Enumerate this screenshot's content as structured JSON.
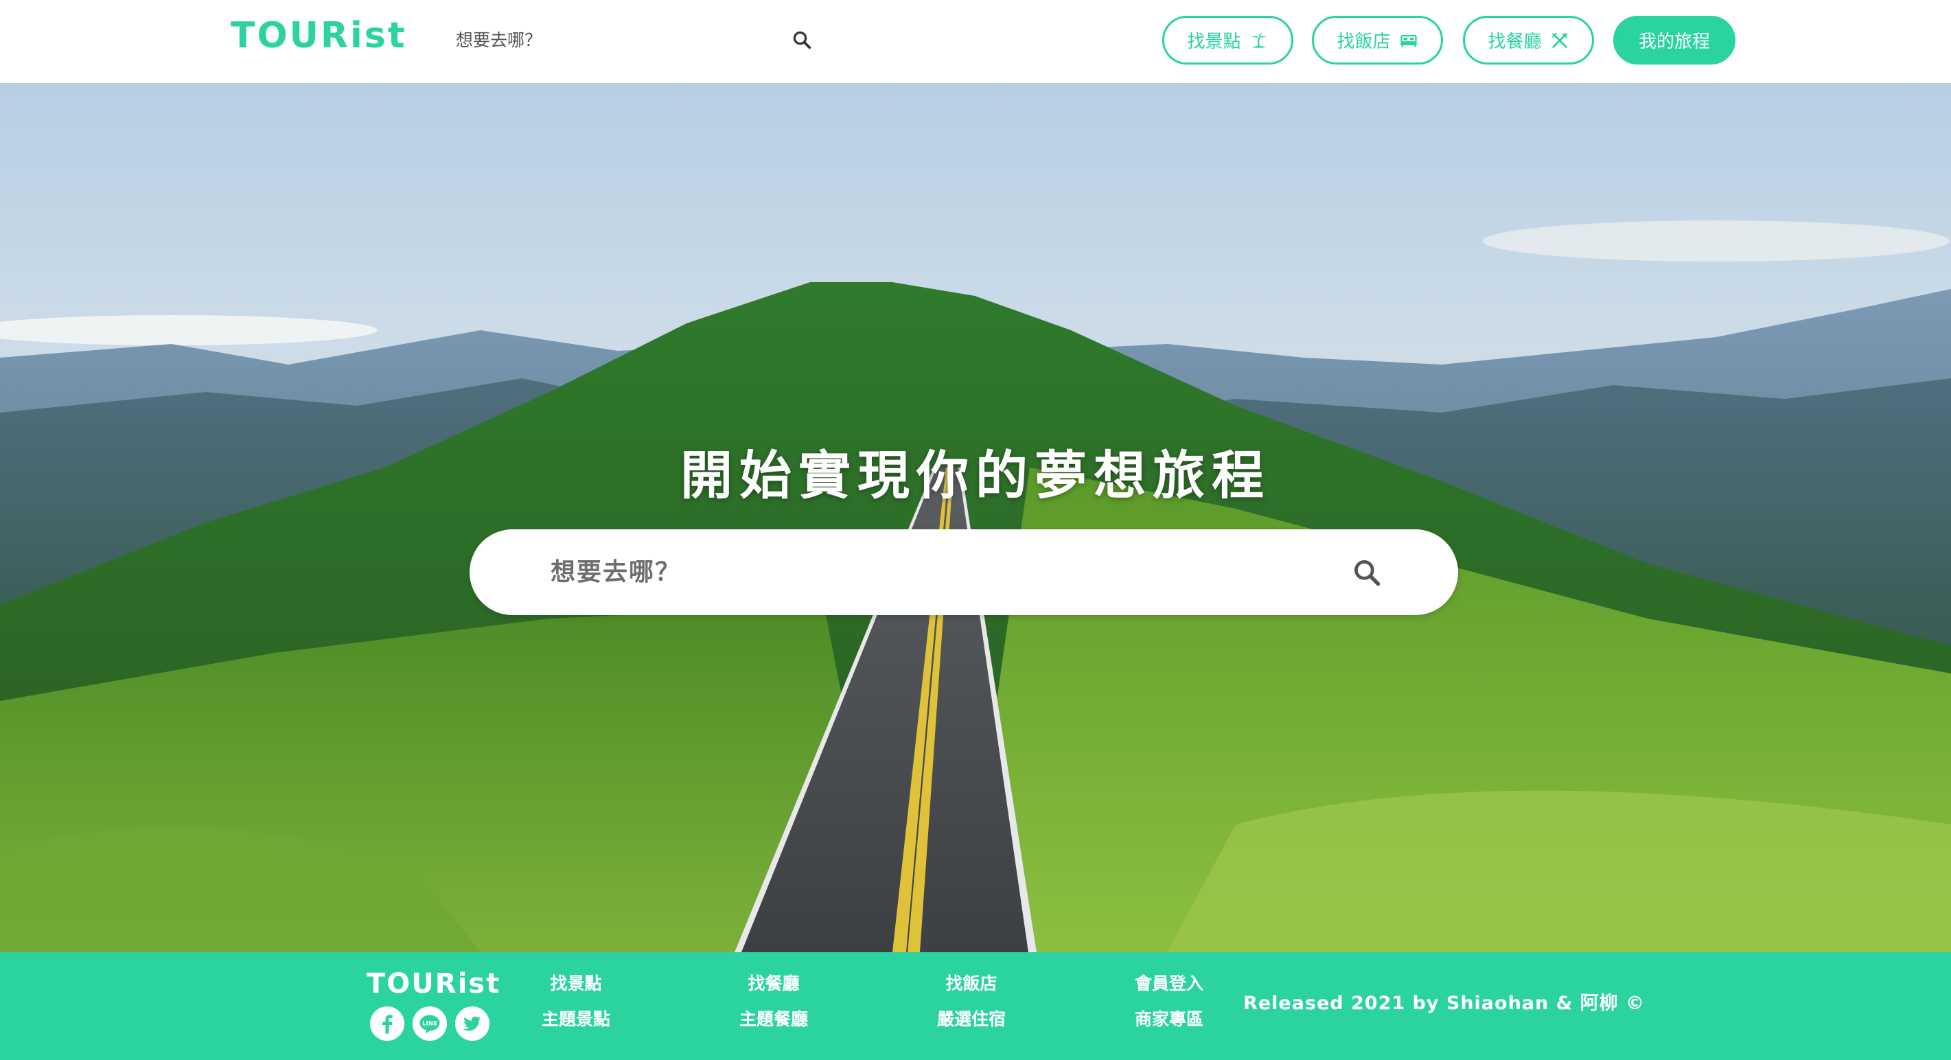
{
  "brand": {
    "logo_text": "TOURist",
    "color_primary": "#2ad3a0"
  },
  "header": {
    "search": {
      "placeholder": "想要去哪？",
      "icon": "search-icon"
    },
    "nav": {
      "spots": {
        "label": "找景點",
        "icon": "palm-tree-icon"
      },
      "hotels": {
        "label": "找飯店",
        "icon": "bed-icon"
      },
      "restaurants": {
        "label": "找餐廳",
        "icon": "utensils-icon"
      },
      "my_trip": {
        "label": "我的旅程"
      }
    }
  },
  "hero": {
    "title": "開始實現你的夢想旅程",
    "search": {
      "placeholder": "想要去哪？",
      "icon": "search-icon"
    }
  },
  "footer": {
    "logo_text": "TOURist",
    "social": [
      "facebook-icon",
      "line-icon",
      "twitter-icon"
    ],
    "links": {
      "spots": "找景點",
      "theme_spots": "主題景點",
      "restaurants": "找餐廳",
      "theme_restaurants": "主題餐廳",
      "hotels": "找飯店",
      "selected_stays": "嚴選住宿",
      "member_login": "會員登入",
      "merchant_area": "商家專區"
    },
    "copyright": "Released 2021 by Shiaohan & 阿柳 ©"
  }
}
